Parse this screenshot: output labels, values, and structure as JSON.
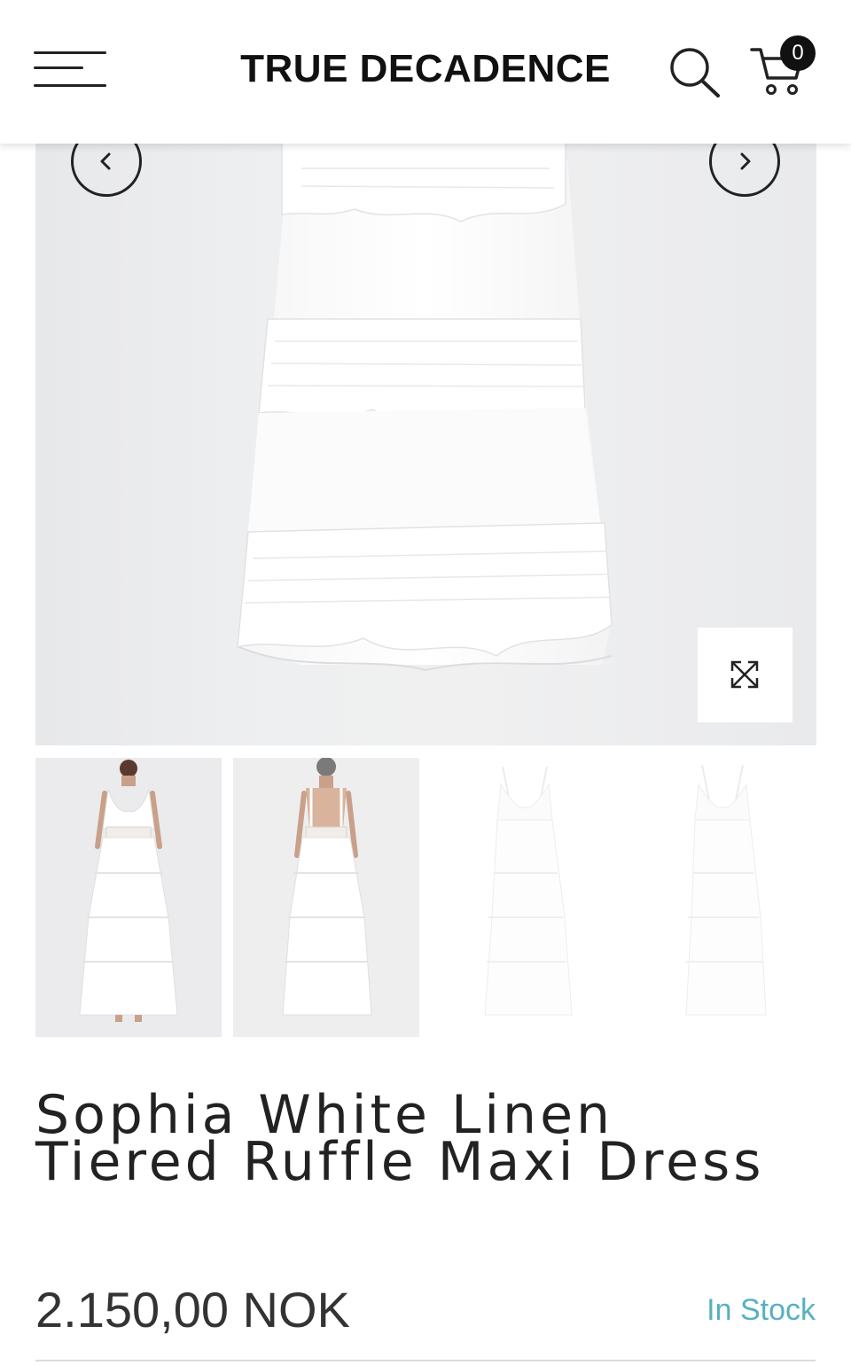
{
  "header": {
    "brand": "TRUE DECADENCE",
    "menu_icon": "hamburger-menu-icon",
    "search_icon": "search-icon",
    "cart_icon": "shopping-cart-icon",
    "cart_count": "0"
  },
  "gallery": {
    "main_image_alt": "white tiered ruffle maxi dress skirt",
    "prev_icon": "chevron-left-icon",
    "next_icon": "chevron-right-icon",
    "zoom_icon": "expand-icon",
    "thumbnail_count": 4,
    "active_thumbnail": 1
  },
  "product": {
    "title": "Sophia White Linen Tiered Ruffle Maxi Dress",
    "price": "2.150,00 NOK",
    "stock_status": "In Stock"
  },
  "colors": {
    "text": "#222222",
    "stock": "#56b1bf",
    "image_bg": "#ececee"
  }
}
